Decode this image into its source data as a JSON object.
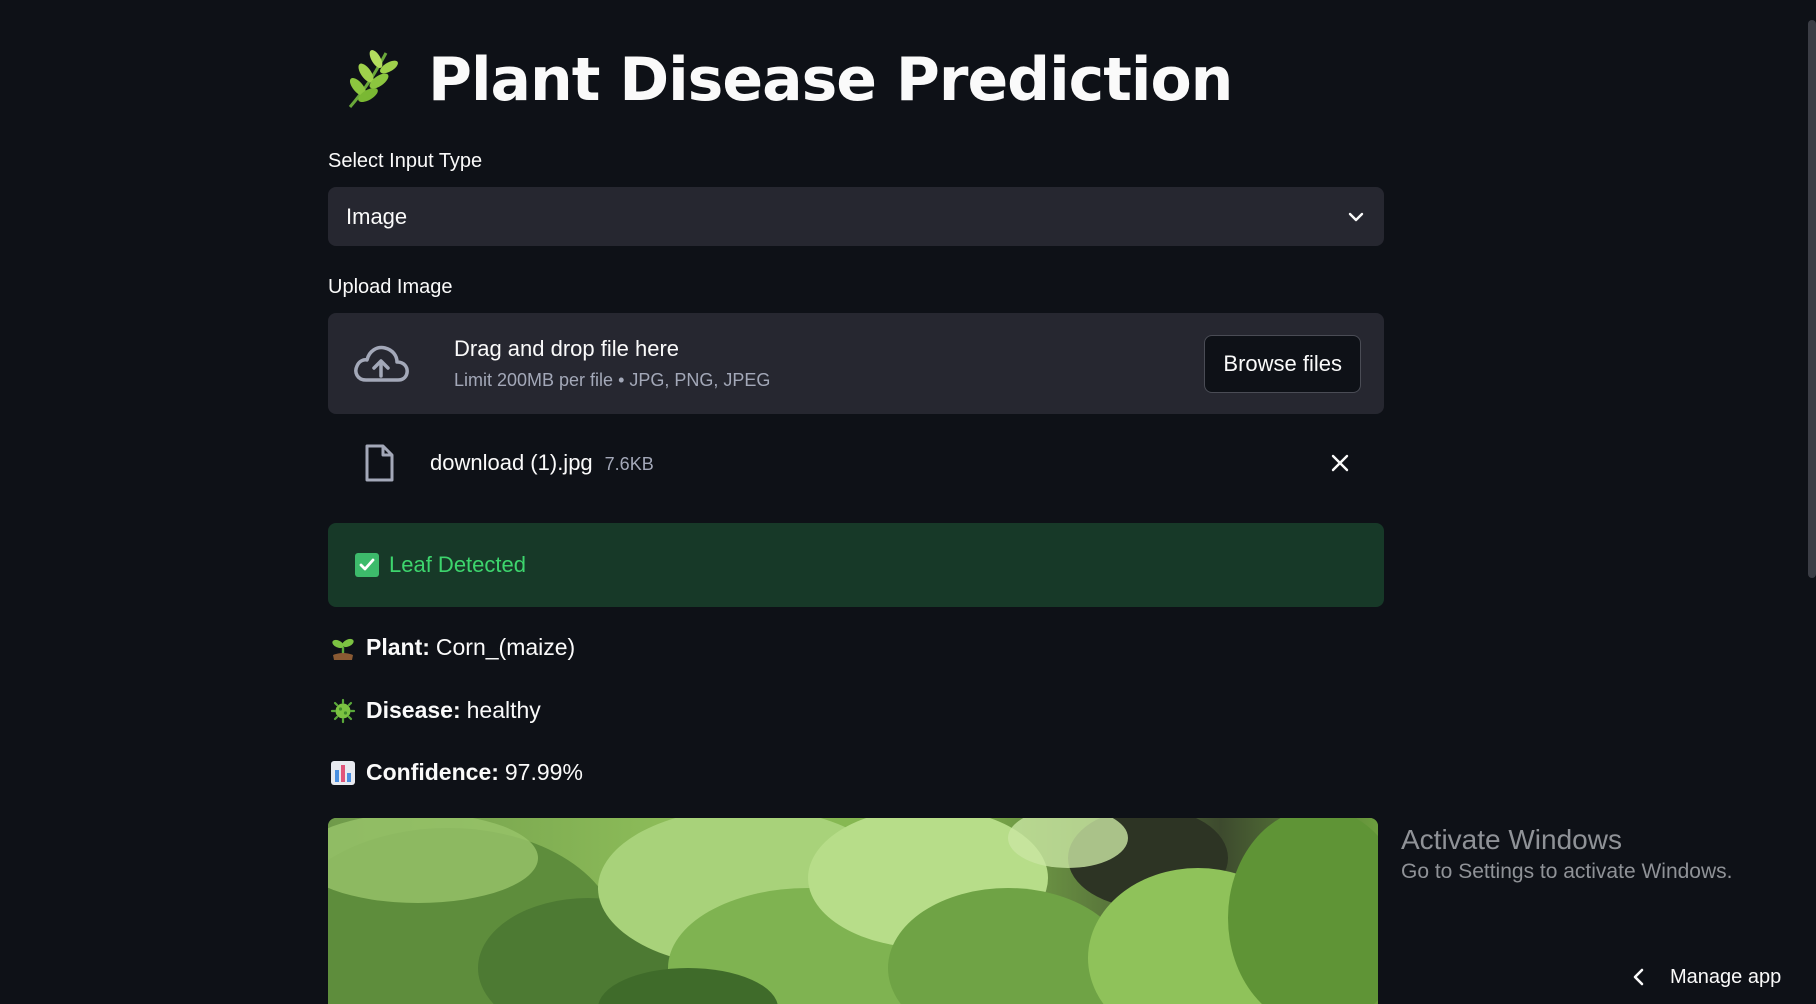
{
  "header": {
    "title": "Plant Disease Prediction",
    "icon": "herb-icon"
  },
  "input_type": {
    "label": "Select Input Type",
    "selected": "Image"
  },
  "upload": {
    "label": "Upload Image",
    "drop_title": "Drag and drop file here",
    "drop_sub": "Limit 200MB per file • JPG, PNG, JPEG",
    "browse_label": "Browse files"
  },
  "file": {
    "name": "download (1).jpg",
    "size": "7.6KB"
  },
  "alert": {
    "text": "Leaf Detected"
  },
  "results": {
    "plant_key": "Plant:",
    "plant_value": "Corn_(maize)",
    "disease_key": "Disease:",
    "disease_value": "healthy",
    "confidence_key": "Confidence:",
    "confidence_value": "97.99%"
  },
  "watermark": {
    "title": "Activate Windows",
    "sub": "Go to Settings to activate Windows."
  },
  "footer": {
    "manage_label": "Manage app"
  },
  "colors": {
    "background": "#0e1117",
    "widget": "#262730",
    "success_bg": "#173928",
    "success_text": "#3dd56d"
  }
}
